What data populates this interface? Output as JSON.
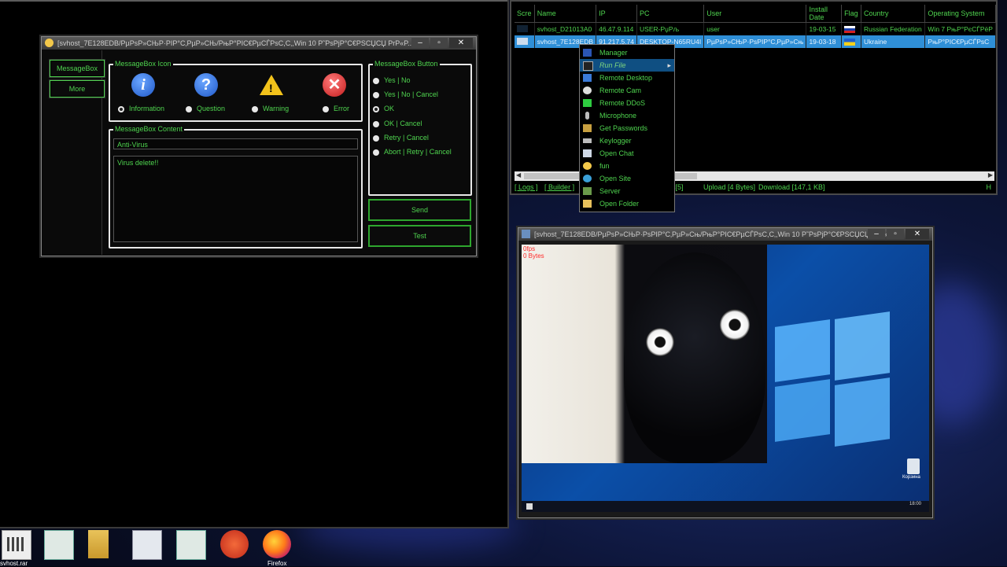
{
  "builder": {
    "title": "[svhost_7E128EDB/PµPsP»CЊP·PIP°C‚PµP»CЊ/PњP°PIC€PµCЃPsC,C‚,Win 10 P˜PsPjP°C€PSCЏCЏ PrP«P...",
    "sidebar": {
      "messagebox_label": "MessageBox",
      "more_label": "More"
    },
    "icon_group": {
      "title": "MessageBox Icon",
      "options": [
        {
          "label": "Information",
          "checked": true,
          "icon": "info-icon",
          "color": "#2a6fdb"
        },
        {
          "label": "Question",
          "checked": false,
          "icon": "question-icon",
          "color": "#2a6fdb"
        },
        {
          "label": "Warning",
          "checked": false,
          "icon": "warning-icon",
          "color": "#f2c21b"
        },
        {
          "label": "Error",
          "checked": false,
          "icon": "error-icon",
          "color": "#d42a2a"
        }
      ]
    },
    "button_group": {
      "title": "MessageBox Button",
      "options": [
        {
          "label": "Yes | No",
          "checked": false
        },
        {
          "label": "Yes | No | Cancel",
          "checked": false
        },
        {
          "label": "OK",
          "checked": true
        },
        {
          "label": "OK | Cancel",
          "checked": false
        },
        {
          "label": "Retry | Cancel",
          "checked": false
        },
        {
          "label": "Abort | Retry | Cancel",
          "checked": false
        }
      ]
    },
    "content_group": {
      "title": "MessageBox Content",
      "title_value": "Anti-Virus",
      "body_value": "Virus delete!!"
    },
    "send_label": "Send",
    "test_label": "Test"
  },
  "clients": {
    "columns": [
      "Scre",
      "Name",
      "IP",
      "PC",
      "User",
      "Install Date",
      "Flag",
      "Country",
      "Operating System"
    ],
    "rows": [
      {
        "name": "svhost_D21013A0",
        "ip": "46.47.9.114",
        "pc": "USER-PџРљ",
        "user": "user",
        "date": "19-03-15",
        "flag": "flag-russia",
        "country": "Russian Federation",
        "os": "Win 7 РњР°РєСЃРёР",
        "selected": false
      },
      {
        "name": "svhost_7E128EDB",
        "ip": "91.217.5.74",
        "pc": "DESKTOP-N65RU4I",
        "user": "PµPsP»CЊP·PsPIP°C‚PµP»Cњ",
        "date": "19-03-18",
        "flag": "flag-ukraine",
        "country": "Ukraine",
        "os": "PњP°PIC€PµCЃPsC",
        "selected": true
      }
    ],
    "status": {
      "logs": "[ Logs ]",
      "builder": "[ Builder ]",
      "connections": "ions[5]",
      "upload": "Upload [4 Bytes]",
      "download": "Download [147,1 KB]",
      "trailing": "H"
    }
  },
  "context_menu": {
    "items": [
      {
        "label": "Manager",
        "icon": "manager-icon",
        "highlighted": false
      },
      {
        "label": "Run File",
        "icon": "run-file-icon",
        "highlighted": true,
        "submenu": true
      },
      {
        "label": "Remote Desktop",
        "icon": "remote-desktop-icon",
        "highlighted": false
      },
      {
        "label": "Remote Cam",
        "icon": "webcam-icon",
        "highlighted": false
      },
      {
        "label": "Remote DDoS",
        "icon": "ddos-icon",
        "highlighted": false
      },
      {
        "label": "Microphone",
        "icon": "microphone-icon",
        "highlighted": false
      },
      {
        "label": "Get Passwords",
        "icon": "key-icon",
        "highlighted": false
      },
      {
        "label": "Keylogger",
        "icon": "keyboard-icon",
        "highlighted": false
      },
      {
        "label": "Open Chat",
        "icon": "chat-icon",
        "highlighted": false
      },
      {
        "label": "fun",
        "icon": "smiley-icon",
        "highlighted": false
      },
      {
        "label": "Open Site",
        "icon": "globe-icon",
        "highlighted": false
      },
      {
        "label": "Server",
        "icon": "server-icon",
        "highlighted": false
      },
      {
        "label": "Open Folder",
        "icon": "folder-icon",
        "highlighted": false
      }
    ]
  },
  "remote_desktop": {
    "title": "[svhost_7E128EDB/PµPsP»CЊP·PsPIP°C‚PµP»Cњ/PњP°PIC€PµCЃPsC,C‚,Win 10 P˜PsPjP°C€PSCЏCЏ PrP«...",
    "fps": "0fps",
    "bytes": "0 Bytes",
    "clock": "18:00",
    "recycle_label": "Корзина"
  },
  "taskbar": {
    "items": [
      {
        "label": "svhost.rar",
        "icon": "archive-icon"
      },
      {
        "label": "",
        "icon": "document-icon"
      },
      {
        "label": "",
        "icon": "folder-icon"
      },
      {
        "label": "",
        "icon": "settings-doc-icon"
      },
      {
        "label": "",
        "icon": "document-icon"
      },
      {
        "label": "",
        "icon": "shortcut-icon"
      },
      {
        "label": "Firefox",
        "icon": "firefox-icon"
      }
    ]
  }
}
